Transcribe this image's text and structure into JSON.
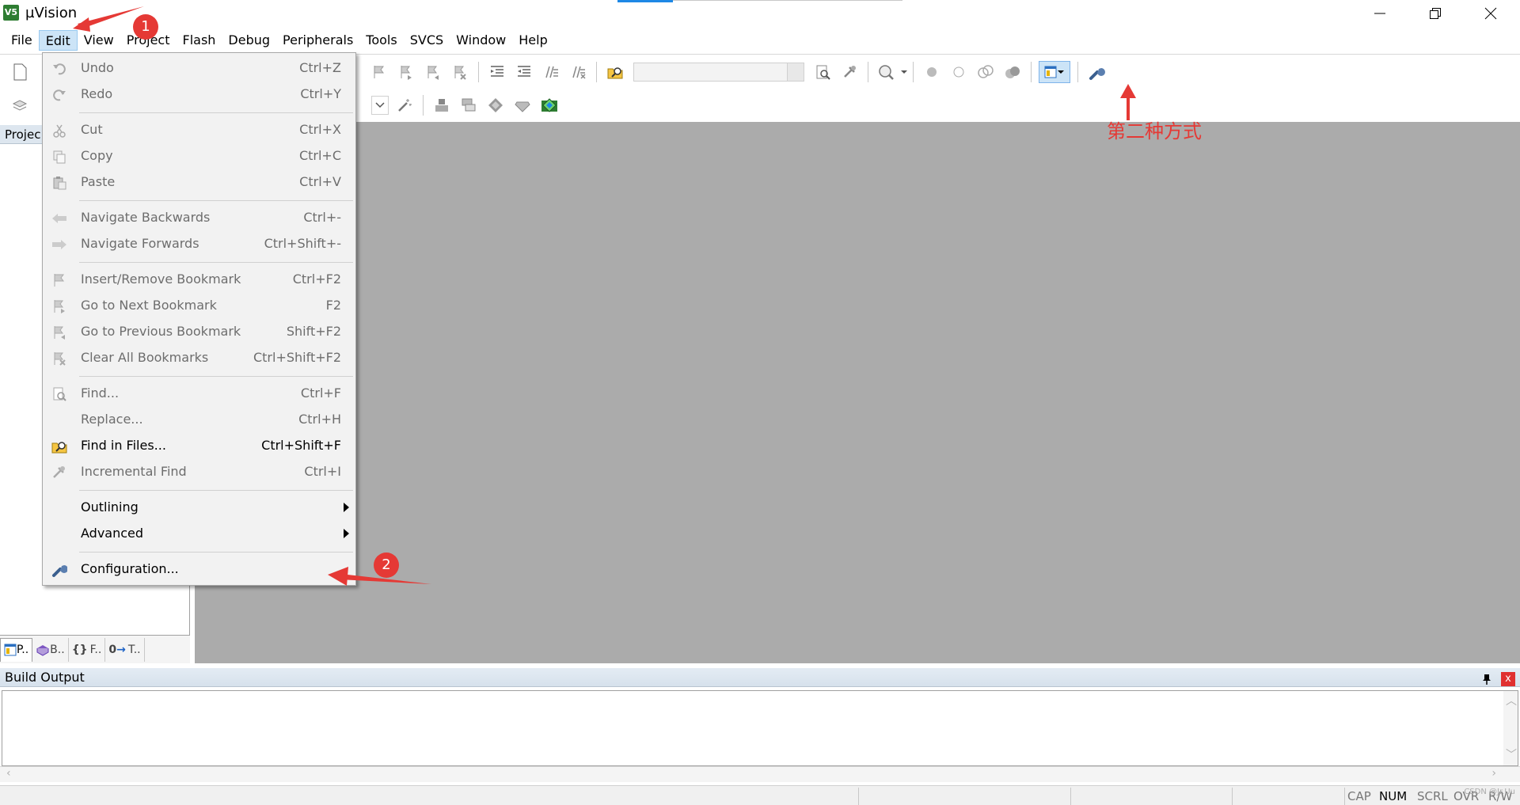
{
  "window": {
    "title": "µVision",
    "app_icon_label": "V5"
  },
  "menubar": {
    "items": [
      {
        "label": "File"
      },
      {
        "label": "Edit",
        "active": true
      },
      {
        "label": "View"
      },
      {
        "label": "Project"
      },
      {
        "label": "Flash"
      },
      {
        "label": "Debug"
      },
      {
        "label": "Peripherals"
      },
      {
        "label": "Tools"
      },
      {
        "label": "SVCS"
      },
      {
        "label": "Window"
      },
      {
        "label": "Help"
      }
    ]
  },
  "project_panel": {
    "header": "Projec",
    "tabs": [
      {
        "label": "P..",
        "icon": "project-icon"
      },
      {
        "label": "B..",
        "icon": "books-icon"
      },
      {
        "label": "F..",
        "icon": "functions-icon"
      },
      {
        "label": "T..",
        "icon": "templates-icon"
      }
    ]
  },
  "edit_menu": {
    "items": [
      {
        "label": "Undo",
        "shortcut": "Ctrl+Z",
        "icon": "undo-icon",
        "enabled": false
      },
      {
        "label": "Redo",
        "shortcut": "Ctrl+Y",
        "icon": "redo-icon",
        "enabled": false
      },
      {
        "label": "Cut",
        "shortcut": "Ctrl+X",
        "icon": "cut-icon",
        "enabled": false
      },
      {
        "label": "Copy",
        "shortcut": "Ctrl+C",
        "icon": "copy-icon",
        "enabled": false
      },
      {
        "label": "Paste",
        "shortcut": "Ctrl+V",
        "icon": "paste-icon",
        "enabled": false
      },
      {
        "label": "Navigate Backwards",
        "shortcut": "Ctrl+-",
        "icon": "arrow-left-icon",
        "enabled": false
      },
      {
        "label": "Navigate Forwards",
        "shortcut": "Ctrl+Shift+-",
        "icon": "arrow-right-icon",
        "enabled": false
      },
      {
        "label": "Insert/Remove Bookmark",
        "shortcut": "Ctrl+F2",
        "icon": "bookmark-flag-icon",
        "enabled": false
      },
      {
        "label": "Go to Next Bookmark",
        "shortcut": "F2",
        "icon": "next-bookmark-icon",
        "enabled": false
      },
      {
        "label": "Go to Previous Bookmark",
        "shortcut": "Shift+F2",
        "icon": "prev-bookmark-icon",
        "enabled": false
      },
      {
        "label": "Clear All Bookmarks",
        "shortcut": "Ctrl+Shift+F2",
        "icon": "clear-bookmarks-icon",
        "enabled": false
      },
      {
        "label": "Find...",
        "shortcut": "Ctrl+F",
        "icon": "find-icon",
        "enabled": false
      },
      {
        "label": "Replace...",
        "shortcut": "Ctrl+H",
        "icon": "",
        "enabled": false
      },
      {
        "label": "Find in Files...",
        "shortcut": "Ctrl+Shift+F",
        "icon": "find-in-files-icon",
        "enabled": true
      },
      {
        "label": "Incremental Find",
        "shortcut": "Ctrl+I",
        "icon": "incremental-find-icon",
        "enabled": false
      },
      {
        "label": "Outlining",
        "shortcut": "",
        "icon": "",
        "enabled": true,
        "submenu": true
      },
      {
        "label": "Advanced",
        "shortcut": "",
        "icon": "",
        "enabled": true,
        "submenu": true
      },
      {
        "label": "Configuration...",
        "shortcut": "",
        "icon": "wrench-icon",
        "enabled": true
      }
    ]
  },
  "build_output": {
    "title": "Build Output",
    "close_label": "x"
  },
  "statusbar": {
    "items": [
      {
        "label": "CAP",
        "on": false
      },
      {
        "label": "NUM",
        "on": true
      },
      {
        "label": "SCRL",
        "on": false
      },
      {
        "label": "OVR",
        "on": false
      },
      {
        "label": "R/W",
        "on": false
      }
    ],
    "watermark": "CSDN @Jr.Uu"
  },
  "annotations": {
    "badge1": "1",
    "badge2": "2",
    "second_method": "第二种方式"
  },
  "colors": {
    "annotation_red": "#e53935",
    "editor_gray": "#ababab",
    "menu_highlight": "#cce4f7"
  }
}
